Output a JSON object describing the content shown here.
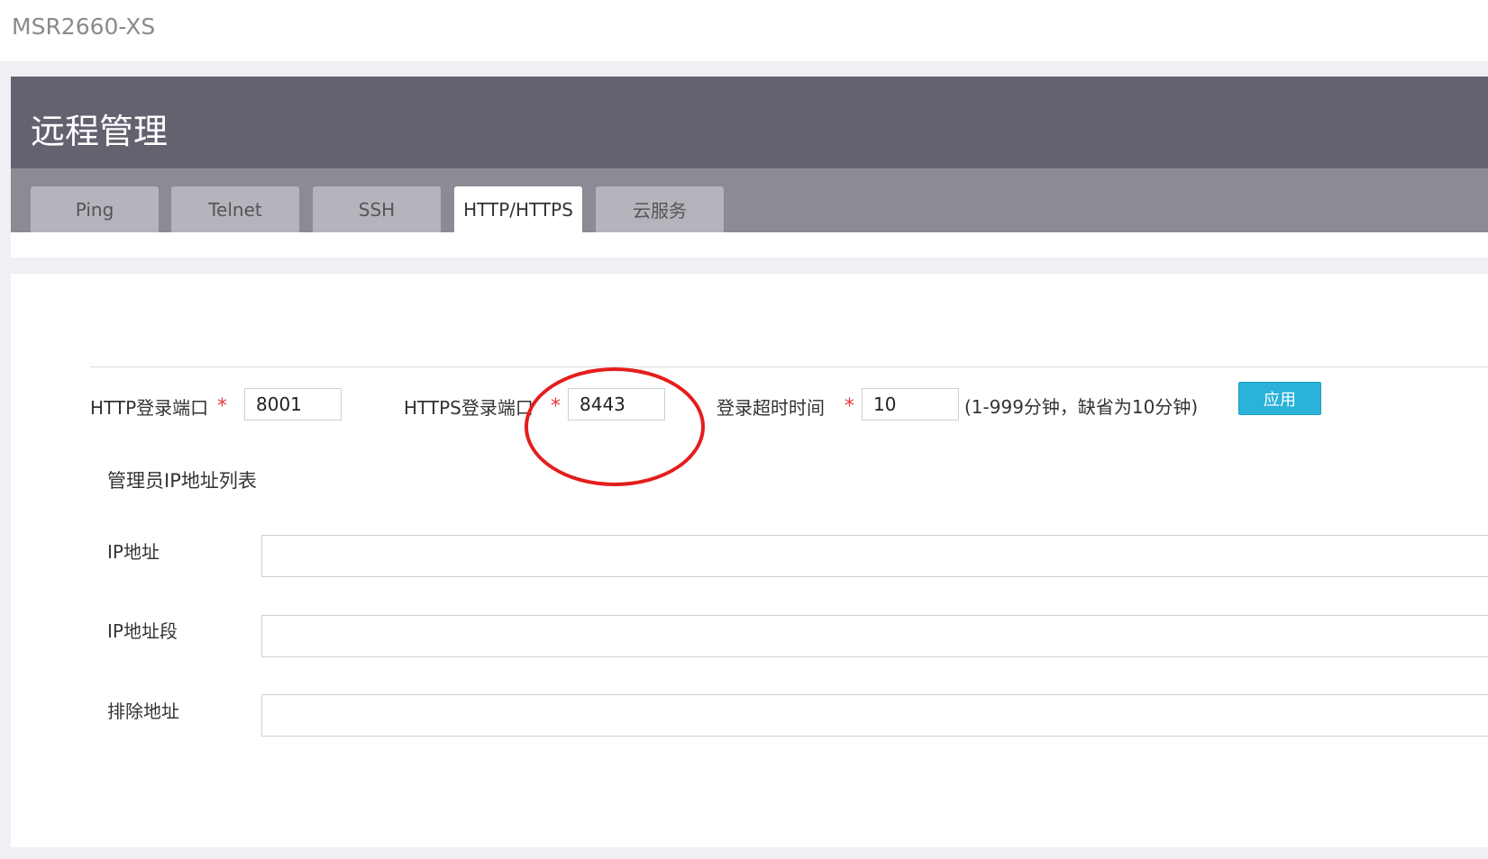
{
  "device": {
    "name": "MSR2660-XS"
  },
  "panel": {
    "title": "远程管理"
  },
  "tabs": [
    {
      "label": "Ping",
      "active": false
    },
    {
      "label": "Telnet",
      "active": false
    },
    {
      "label": "SSH",
      "active": false
    },
    {
      "label": "HTTP/HTTPS",
      "active": true
    },
    {
      "label": "云服务",
      "active": false
    }
  ],
  "form": {
    "http_port": {
      "label": "HTTP登录端口",
      "required_mark": "*",
      "value": "8001"
    },
    "https_port": {
      "label": "HTTPS登录端口",
      "required_mark": "*",
      "value": "8443"
    },
    "timeout": {
      "label": "登录超时时间",
      "required_mark": "*",
      "value": "10",
      "hint": "(1-999分钟，缺省为10分钟)"
    },
    "apply_label": "应用"
  },
  "admin_ip": {
    "section_title": "管理员IP地址列表",
    "ip_address_label": "IP地址",
    "ip_range_label": "IP地址段",
    "exclude_label": "排除地址"
  },
  "colors": {
    "header_bg": "#62636f",
    "tab_strip_bg": "#8c8b95",
    "apply_button": "#2ab2d8",
    "required_mark": "#e23a3a",
    "annotation_circle": "#e41d1d"
  }
}
